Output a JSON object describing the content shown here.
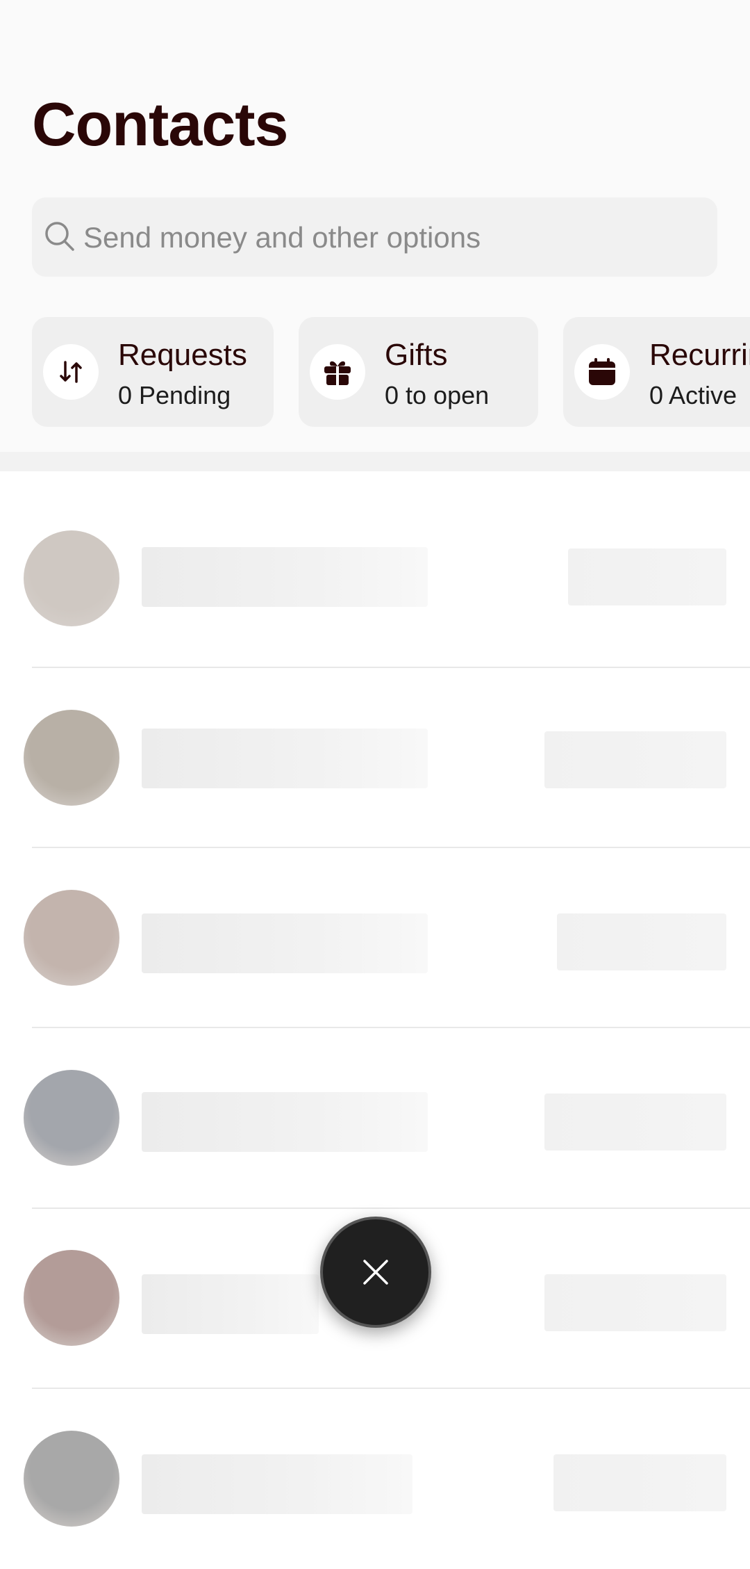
{
  "page": {
    "title": "Contacts"
  },
  "search": {
    "placeholder": "Send money and other options"
  },
  "chips": [
    {
      "title": "Requests",
      "subtitle": "0 Pending",
      "icon": "arrows-up-down-icon"
    },
    {
      "title": "Gifts",
      "subtitle": "0 to open",
      "icon": "gift-icon"
    },
    {
      "title": "Recurring",
      "subtitle": "0 Active",
      "icon": "calendar-icon"
    }
  ],
  "contacts": {
    "state": "loading",
    "rows": [
      {
        "avatar_color": "#cfc8c2"
      },
      {
        "avatar_color": "#b8b0a6"
      },
      {
        "avatar_color": "#c3b4ad"
      },
      {
        "avatar_color": "#a3a6ac"
      },
      {
        "avatar_color": "#b39c98"
      },
      {
        "avatar_color": "#a8a8a8"
      }
    ]
  },
  "fab": {
    "icon": "close-icon"
  },
  "colors": {
    "accent": "#2a0707",
    "fab_bg": "#202020"
  }
}
